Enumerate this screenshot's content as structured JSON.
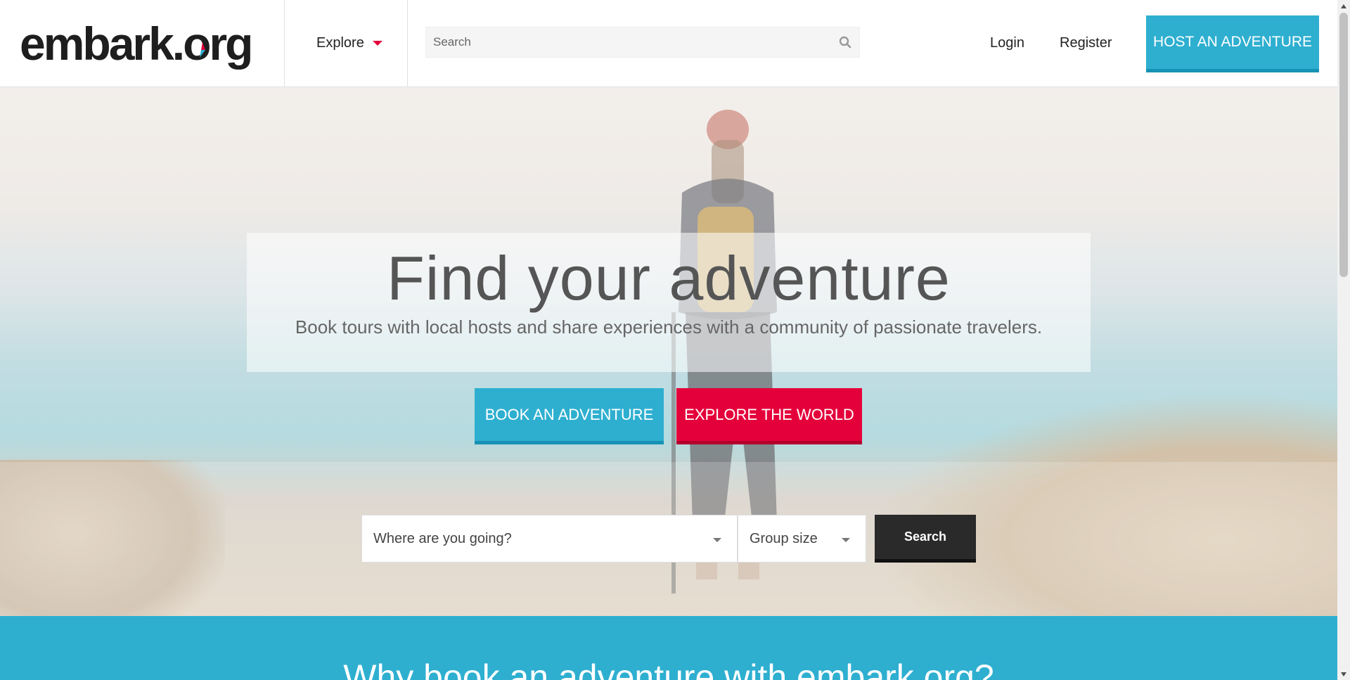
{
  "header": {
    "logo_text": "embark.org",
    "explore_label": "Explore",
    "search_placeholder": "Search",
    "login_label": "Login",
    "register_label": "Register",
    "host_button_label": "HOST AN ADVENTURE"
  },
  "hero": {
    "title": "Find your adventure",
    "subtitle": "Book tours with local hosts and share experiences with a community of passionate travelers.",
    "book_button_label": "BOOK AN ADVENTURE",
    "explore_button_label": "EXPLORE THE WORLD",
    "destination_placeholder": "Where are you going?",
    "group_size_placeholder": "Group size",
    "search_button_label": "Search"
  },
  "why": {
    "heading": "Why book an adventure with embark.org?"
  },
  "colors": {
    "accent_blue": "#2eafd0",
    "accent_red": "#e4003a",
    "dark_button": "#2a2a2a"
  },
  "icons": {
    "search": "search-icon",
    "explore_caret": "caret-down-icon",
    "select_caret": "chevron-down-icon",
    "compass": "compass-needle-icon"
  }
}
